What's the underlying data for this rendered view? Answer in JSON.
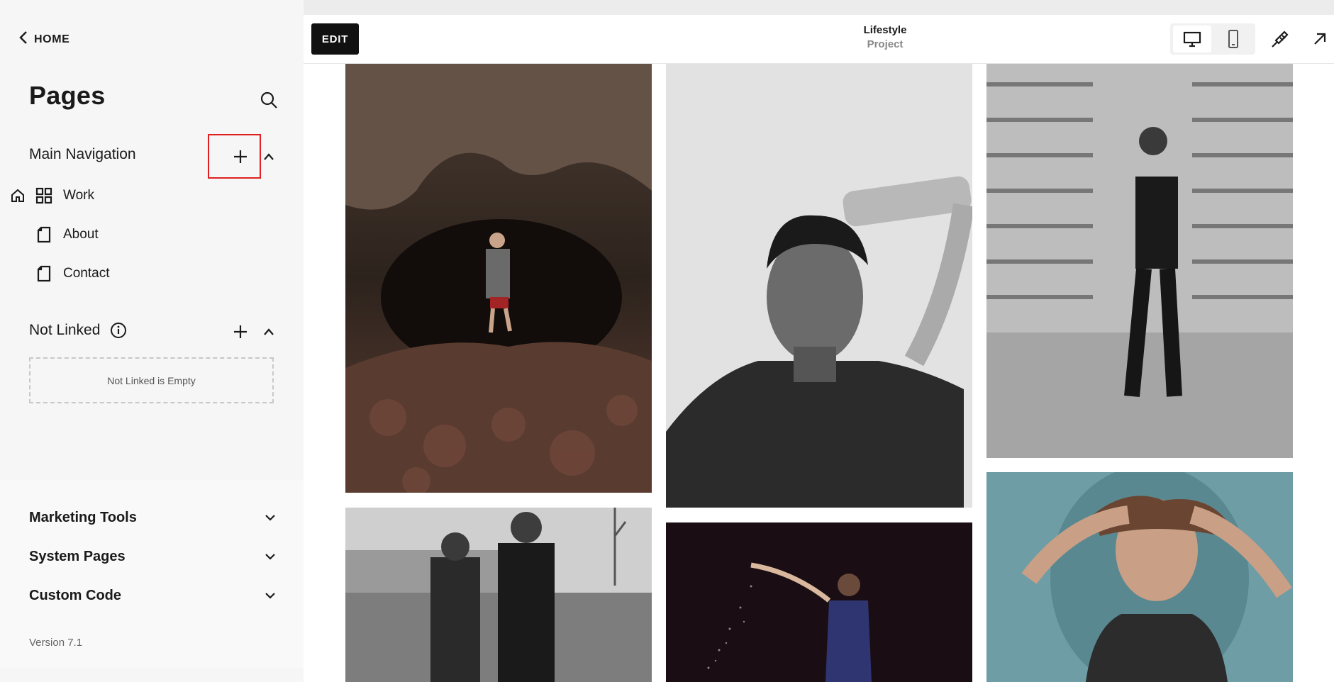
{
  "sidebar": {
    "back_label": "HOME",
    "title": "Pages",
    "main_navigation": {
      "heading": "Main Navigation",
      "items": [
        {
          "label": "Work",
          "icon": "grid-icon",
          "is_home": true
        },
        {
          "label": "About",
          "icon": "page-icon",
          "is_home": false
        },
        {
          "label": "Contact",
          "icon": "page-icon",
          "is_home": false
        }
      ]
    },
    "not_linked": {
      "heading": "Not Linked",
      "empty_text": "Not Linked is Empty"
    },
    "collapsible_sections": [
      {
        "label": "Marketing Tools"
      },
      {
        "label": "System Pages"
      },
      {
        "label": "Custom Code"
      }
    ],
    "version": "Version 7.1"
  },
  "preview": {
    "edit_label": "EDIT",
    "page_name": "Lifestyle",
    "page_type": "Project",
    "device_mode": "desktop"
  },
  "colors": {
    "highlight": "#e02020",
    "edit_button": "#111111"
  }
}
